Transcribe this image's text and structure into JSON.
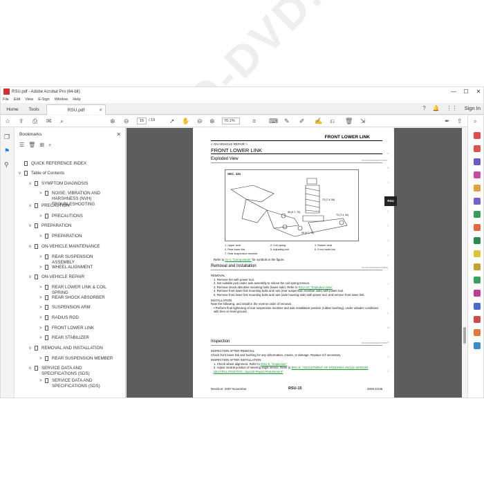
{
  "window": {
    "title": "RSU.pdf - Adobe Acrobat Pro (64-bit)",
    "controls": [
      "—",
      "☐",
      "✕"
    ]
  },
  "menu": [
    "File",
    "Edit",
    "View",
    "E-Sign",
    "Window",
    "Help"
  ],
  "tabs": {
    "home": "Home",
    "tools": "Tools",
    "document": "RSU.pdf",
    "sign_in": "Sign In"
  },
  "toolbar": {
    "current_page": "15",
    "page_total": "/  19",
    "zoom": "70,1%"
  },
  "bookmarks": {
    "title": "Bookmarks",
    "items": [
      {
        "label": "QUICK REFERENCE INDEX",
        "level": 0,
        "expander": ""
      },
      {
        "label": "Table of Contents",
        "level": 0,
        "expander": "v"
      },
      {
        "label": "SYMPTOM DIAGNOSIS",
        "level": 1,
        "expander": "v"
      },
      {
        "label": "NOISE, VIBRATION AND HARSHNESS (NVH) TROUBLESHOOTING",
        "level": 2,
        "expander": ">"
      },
      {
        "label": "PRECAUTION",
        "level": 1,
        "expander": "v"
      },
      {
        "label": "PRECAUTIONS",
        "level": 2,
        "expander": ">"
      },
      {
        "label": "PREPARATION",
        "level": 1,
        "expander": "v"
      },
      {
        "label": "PREPARATION",
        "level": 2,
        "expander": ">"
      },
      {
        "label": "ON-VEHICLE MAINTENANCE",
        "level": 1,
        "expander": "v"
      },
      {
        "label": "REAR SUSPENSION ASSEMBLY",
        "level": 2,
        "expander": ">"
      },
      {
        "label": "WHEEL ALIGNMENT",
        "level": 2,
        "expander": ">"
      },
      {
        "label": "ON-VEHICLE REPAIR",
        "level": 1,
        "expander": "v"
      },
      {
        "label": "REAR LOWER LINK & COIL SPRING",
        "level": 2,
        "expander": ">"
      },
      {
        "label": "REAR SHOCK ABSORBER",
        "level": 2,
        "expander": ">"
      },
      {
        "label": "SUSPENSION ARM",
        "level": 2,
        "expander": ">"
      },
      {
        "label": "RADIUS ROD",
        "level": 2,
        "expander": ">"
      },
      {
        "label": "FRONT LOWER LINK",
        "level": 2,
        "expander": ">"
      },
      {
        "label": "REAR STABILIZER",
        "level": 2,
        "expander": ">"
      },
      {
        "label": "REMOVAL AND INSTALLATION",
        "level": 1,
        "expander": "v"
      },
      {
        "label": "REAR SUSPENSION MEMBER",
        "level": 2,
        "expander": ">"
      },
      {
        "label": "SERVICE DATA AND SPECIFICATIONS (SDS)",
        "level": 1,
        "expander": "v"
      },
      {
        "label": "SERVICE DATA AND SPECIFICATIONS (SDS)",
        "level": 2,
        "expander": ">"
      }
    ]
  },
  "page": {
    "header": "FRONT LOWER LINK",
    "breadcrumb": "< ON-VEHICLE REPAIR >",
    "title": "FRONT LOWER LINK",
    "exploded_view": "Exploded View",
    "diagram_label": "SEC. 431",
    "legend": [
      "1.    Upper seat",
      "2.    Coil spring",
      "3.    Rubber seat",
      "4.    Rear lower link",
      "5.    Adjusting bolt",
      "6.    Front lower link",
      "7.    Rear suspension member"
    ],
    "refer_prefix": "Refer to ",
    "refer_link": "GI-4, \"Components\"",
    "refer_suffix": " for symbols in the figure.",
    "removal_title": "Removal and Installation",
    "removal_label": "REMOVAL",
    "removal_steps": [
      "1.    Remove tire with power tool.",
      "2.    Set suitable jack under axle assembly to relieve the coil spring tension.",
      "3.    Remove shock absorber mounting bolts (lower side). Refer to ",
      "4.    Remove front lower link mounting bolts and nuts (rear suspension member side) with power tool.",
      "5.    Remove front lower link mounting bolts and nuts (axle housing side) with power tool, and remove front lower link."
    ],
    "removal_link": "RSU-10, \"Exploded View\"",
    "installation_label": "INSTALLATION",
    "installation_text": "Note the following, and install in the reverse order of removal.",
    "installation_bullet": "•  Perform final tightening of rear suspension member and axle installation position (rubber bushing), under unladen conditions with tires on level ground.",
    "inspection_title": "Inspection",
    "after_removal_label": "INSPECTION AFTER REMOVAL",
    "after_removal_text": "Check front lower link and bushing for any deformation, cracks, or damage. Replace it if necessary.",
    "after_install_label": "INSPECTION AFTER INSTALLATION",
    "after_install_1": "1.    Check wheel alignment. Refer to ",
    "after_install_1_link": "RSU-6, \"Inspection\"",
    "after_install_2": "2.    Adjust neutral position of steering angle sensor. Refer to ",
    "after_install_2_link": "BRC-8, \"ADJUSTMENT OF STEERING ANGLE SENSOR NEUTRAL POSITION : Special Repair Requirement\"",
    "footer_left": "Revision: 2007 November",
    "footer_center": "RSU-15",
    "footer_right": "2008 EX35",
    "side_tab": "RSU",
    "side_letters": [
      "A",
      "B",
      "C",
      "D",
      "E",
      "F",
      "G",
      "H",
      "I",
      "J",
      "K",
      "L",
      "M",
      "N",
      "O",
      "P"
    ],
    "section_codes": [
      "INFOID:0000000001758877",
      "INFOID:0000000001758878",
      "INFOID:0000000001758879"
    ],
    "callouts": [
      "73 (7.4, 54)",
      "73 (7.4, 54)",
      "95 (9.7, 70)",
      "95 (9.7, 70)"
    ]
  },
  "watermark": "PPCD-DVD.COM"
}
